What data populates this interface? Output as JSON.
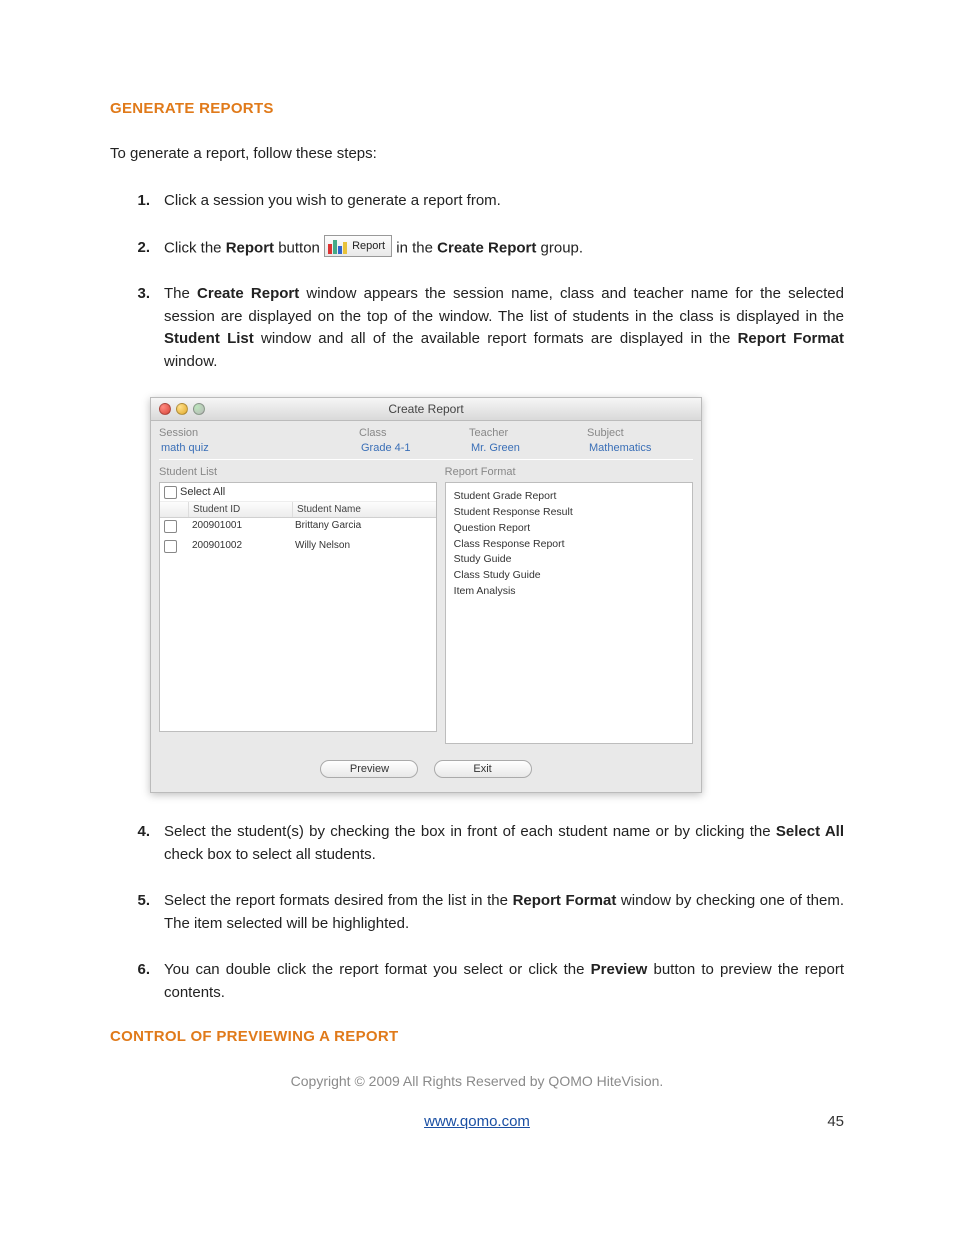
{
  "headings": {
    "generate_reports": "GENERATE REPORTS",
    "control_preview": "CONTROL OF PREVIEWING A REPORT"
  },
  "intro": "To generate a report, follow these steps:",
  "steps": {
    "n1": "1.",
    "s1": "Click a session you wish to generate a report from.",
    "n2": "2.",
    "s2_a": "Click the ",
    "s2_report_word": "Report",
    "s2_b": " button ",
    "s2_btn_label": "Report",
    "s2_c": " in the ",
    "s2_create_report": "Create Report",
    "s2_d": " group.",
    "n3": "3.",
    "s3_a": "The ",
    "s3_cr": "Create Report",
    "s3_b": " window appears the session name, class and teacher name for the selected session are displayed on the top of the window. The list of students in the class is displayed in the ",
    "s3_sl": "Student List",
    "s3_c": " window and all of the available report formats are displayed in the ",
    "s3_rf": "Report Format",
    "s3_d": " window.",
    "n4": "4.",
    "s4_a": "Select the student(s) by checking the box in front of each student name or by clicking the ",
    "s4_sa": "Select All",
    "s4_b": " check box to select all students.",
    "n5": "5.",
    "s5_a": "Select the report formats desired from the list in the ",
    "s5_rf": "Report Format",
    "s5_b": " window by checking one of them. The item selected will be highlighted.",
    "n6": "6.",
    "s6_a": "You can double click the report format you select or click the ",
    "s6_pv": "Preview",
    "s6_b": " button to preview the report contents."
  },
  "win": {
    "title": "Create Report",
    "labels": {
      "session": "Session",
      "class": "Class",
      "teacher": "Teacher",
      "subject": "Subject",
      "student_list": "Student List",
      "report_format": "Report Format",
      "select_all": "Select All",
      "student_id": "Student ID",
      "student_name": "Student Name"
    },
    "values": {
      "session": "math quiz",
      "class": "Grade 4-1",
      "teacher": "Mr. Green",
      "subject": "Mathematics"
    },
    "students": [
      {
        "id": "200901001",
        "name": "Brittany Garcia"
      },
      {
        "id": "200901002",
        "name": "Willy Nelson"
      }
    ],
    "formats": [
      "Student Grade Report",
      "Student Response Result",
      "Question Report",
      "Class Response Report",
      "Study Guide",
      "Class Study Guide",
      "Item Analysis"
    ],
    "buttons": {
      "preview": "Preview",
      "exit": "Exit"
    }
  },
  "footer": {
    "copyright": "Copyright © 2009 All Rights Reserved by QOMO HiteVision.",
    "url": "www.qomo.com",
    "page": "45"
  }
}
